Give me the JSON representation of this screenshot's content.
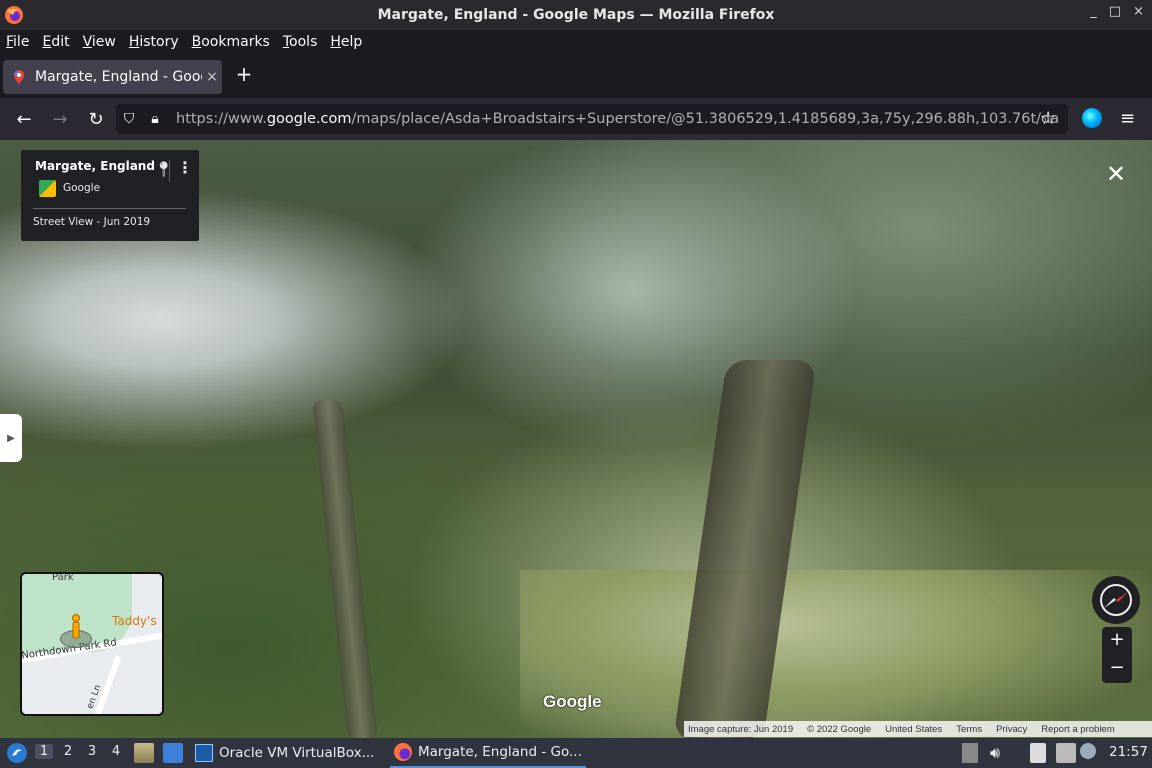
{
  "window": {
    "title": "Margate, England - Google Maps — Mozilla Firefox",
    "controls": [
      "_",
      "□",
      "×"
    ]
  },
  "menu": [
    "File",
    "Edit",
    "View",
    "History",
    "Bookmarks",
    "Tools",
    "Help"
  ],
  "tab": {
    "label": "Margate, England - Goog",
    "close": "×",
    "new": "+"
  },
  "nav": {
    "back": "←",
    "forward": "→",
    "reload": "↻",
    "url_prefix": "https://www.",
    "url_domain": "google.com",
    "url_rest": "/maps/place/Asda+Broadstairs+Superstore/@51.3806529,1.4185689,3a,75y,296.88h,103.76t/da"
  },
  "infocard": {
    "title": "Margate, England",
    "provider": "Google",
    "capture": "Street View - Jun 2019"
  },
  "minimap": {
    "park_label": "Park",
    "poi": "Taddy's",
    "road": "Northdown Park Rd",
    "lane": "en Ln"
  },
  "watermark": "Google",
  "zoom": {
    "in": "+",
    "out": "−"
  },
  "footer": {
    "capture": "Image capture: Jun 2019",
    "copyright": "© 2022 Google",
    "country": "United States",
    "terms": "Terms",
    "privacy": "Privacy",
    "report": "Report a problem"
  },
  "taskbar": {
    "workspaces": [
      "1",
      "2",
      "3",
      "4"
    ],
    "tasks": [
      {
        "label": "Oracle VM VirtualBox..."
      },
      {
        "label": "Margate, England - Go..."
      }
    ],
    "clock": "21:57"
  },
  "colors": {
    "firefox_chrome": "#2b2a33",
    "taskbar": "#2f343f",
    "accent": "#5294e2"
  }
}
